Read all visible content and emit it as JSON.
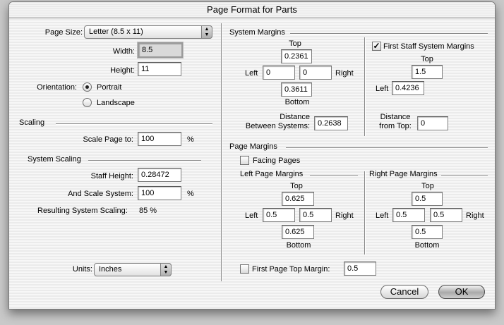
{
  "window": {
    "title": "Page Format for Parts"
  },
  "page": {
    "page_size_label": "Page Size:",
    "page_size_value": "Letter (8.5 x 11)",
    "width_label": "Width:",
    "width_value": "8.5",
    "height_label": "Height:",
    "height_value": "11",
    "orientation_label": "Orientation:",
    "portrait_label": "Portrait",
    "landscape_label": "Landscape"
  },
  "scaling": {
    "header": "Scaling",
    "scale_page_label": "Scale Page to:",
    "scale_page_value": "100",
    "percent": "%"
  },
  "system_scaling": {
    "header": "System Scaling",
    "staff_height_label": "Staff Height:",
    "staff_height_value": "0.28472",
    "and_scale_label": "And Scale System:",
    "and_scale_value": "100",
    "percent": "%",
    "resulting_label": "Resulting System Scaling:",
    "resulting_value": "85 %"
  },
  "units": {
    "label": "Units:",
    "value": "Inches"
  },
  "system_margins": {
    "header": "System Margins",
    "top_label": "Top",
    "top_value": "0.2361",
    "left_label": "Left",
    "left_value": "0",
    "right_value": "0",
    "right_label": "Right",
    "bottom_value": "0.3611",
    "bottom_label": "Bottom",
    "distance_label_1": "Distance",
    "distance_label_2": "Between Systems:",
    "distance_value": "0.2638"
  },
  "first_staff": {
    "checkbox_label": "First Staff System Margins",
    "checked": "✓",
    "top_label": "Top",
    "top_value": "1.5",
    "left_label": "Left",
    "left_value": "0.4236",
    "distance_label_1": "Distance",
    "distance_label_2": "from Top:",
    "distance_value": "0"
  },
  "page_margins": {
    "header": "Page Margins",
    "facing_pages_label": "Facing Pages",
    "left_header": "Left Page Margins",
    "right_header": "Right Page Margins",
    "left": {
      "top_label": "Top",
      "top_value": "0.625",
      "left_label": "Left",
      "left_value": "0.5",
      "right_value": "0.5",
      "right_label": "Right",
      "bottom_value": "0.625",
      "bottom_label": "Bottom"
    },
    "right": {
      "top_label": "Top",
      "top_value": "0.5",
      "left_label": "Left",
      "left_value": "0.5",
      "right_value": "0.5",
      "right_label": "Right",
      "bottom_value": "0.5",
      "bottom_label": "Bottom"
    },
    "first_page_top_label": "First Page Top Margin:",
    "first_page_top_value": "0.5"
  },
  "buttons": {
    "cancel": "Cancel",
    "ok": "OK"
  }
}
